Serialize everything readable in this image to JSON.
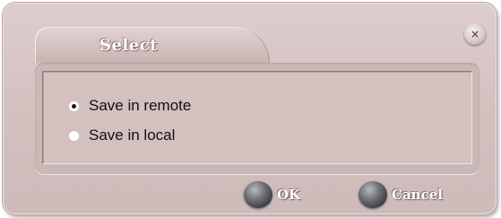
{
  "dialog": {
    "title": "Select",
    "close_icon": "close-icon",
    "close_glyph": "×"
  },
  "options": [
    {
      "label": "Save in remote",
      "selected": true
    },
    {
      "label": "Save in local",
      "selected": false
    }
  ],
  "buttons": {
    "ok_label": "OK",
    "cancel_label": "Cancel"
  },
  "colors": {
    "dialog_bg": "#d3c1c0",
    "title_text": "#ffffff",
    "button_orb": "#4a4b50"
  }
}
